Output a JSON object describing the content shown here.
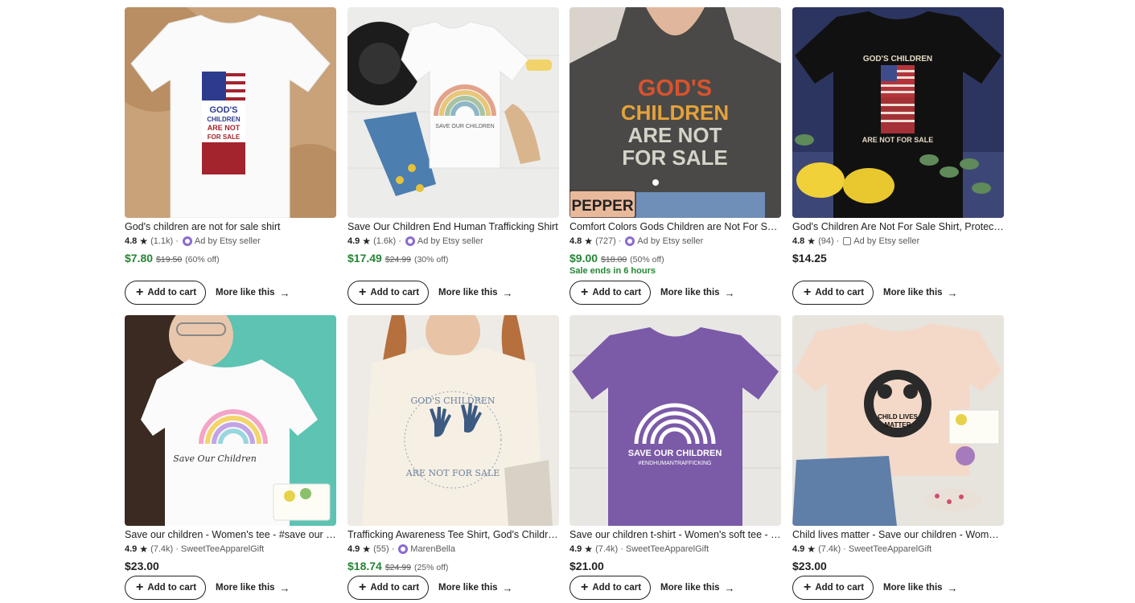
{
  "ui": {
    "add_to_cart": "Add to cart",
    "more_like_this": "More like this",
    "plus_icon": "+",
    "arrow_icon": "→",
    "star_icon": "★",
    "ad_text": "Ad by Etsy seller"
  },
  "listings": [
    {
      "title": "God's children are not for sale shirt",
      "rating": "4.8",
      "reviews": "(1.1k)",
      "seller_type": "ad",
      "seller": "Ad by Etsy seller",
      "price": "$7.80",
      "original_price": "$19.50",
      "discount": "(60% off)",
      "sale_ends": ""
    },
    {
      "title": "Save Our Children End Human Trafficking Shirt",
      "rating": "4.9",
      "reviews": "(1.6k)",
      "seller_type": "ad",
      "seller": "Ad by Etsy seller",
      "price": "$17.49",
      "original_price": "$24.99",
      "discount": "(30% off)",
      "sale_ends": ""
    },
    {
      "title": "Comfort Colors Gods Children are Not For Sale Shirt",
      "rating": "4.8",
      "reviews": "(727)",
      "seller_type": "ad",
      "seller": "Ad by Etsy seller",
      "price": "$9.00",
      "original_price": "$18.00",
      "discount": "(50% off)",
      "sale_ends": "Sale ends in 6 hours",
      "image_label": "PEPPER",
      "shirt_text": [
        "GOD'S",
        "CHILDREN",
        "ARE NOT",
        "FOR SALE"
      ]
    },
    {
      "title": "God's Children Are Not For Sale Shirt, Protect Our Children",
      "rating": "4.8",
      "reviews": "(94)",
      "seller_type": "ad-shop",
      "seller": "Ad by Etsy seller",
      "price": "$14.25",
      "original_price": "",
      "discount": "",
      "sale_ends": "",
      "shirt_text": [
        "GOD'S CHILDREN",
        "ARE NOT FOR SALE"
      ]
    },
    {
      "title": "Save our children - Women's tee - #save our children",
      "rating": "4.9",
      "reviews": "(7.4k)",
      "seller_type": "shop",
      "seller": "SweetTeeApparelGift",
      "price": "$23.00",
      "original_price": "",
      "discount": "",
      "sale_ends": "",
      "shirt_text": [
        "Save Our Children"
      ]
    },
    {
      "title": "Trafficking Awareness Tee Shirt, God's Children Are Not For Sale",
      "rating": "4.9",
      "reviews": "(55)",
      "seller_type": "star-seller",
      "seller": "MarenBella",
      "price": "$18.74",
      "original_price": "$24.99",
      "discount": "(25% off)",
      "sale_ends": ""
    },
    {
      "title": "Save our children t-shirt - Women's soft tee - End human trafficking",
      "rating": "4.9",
      "reviews": "(7.4k)",
      "seller_type": "shop",
      "seller": "SweetTeeApparelGift",
      "price": "$21.00",
      "original_price": "",
      "discount": "",
      "sale_ends": "",
      "shirt_text": [
        "SAVE OUR CHILDREN",
        "#ENDHUMANTRAFFICKING"
      ]
    },
    {
      "title": "Child lives matter - Save our children - Women's tee",
      "rating": "4.9",
      "reviews": "(7.4k)",
      "seller_type": "shop",
      "seller": "SweetTeeApparelGift",
      "price": "$23.00",
      "original_price": "",
      "discount": "",
      "sale_ends": "",
      "shirt_text": [
        "CHILD LIVES",
        "MATTER"
      ]
    }
  ],
  "colors": {
    "sale_green": "#258635",
    "text_dark": "#222222",
    "text_muted": "#595959",
    "ad_purple": "#8a6bd1"
  }
}
